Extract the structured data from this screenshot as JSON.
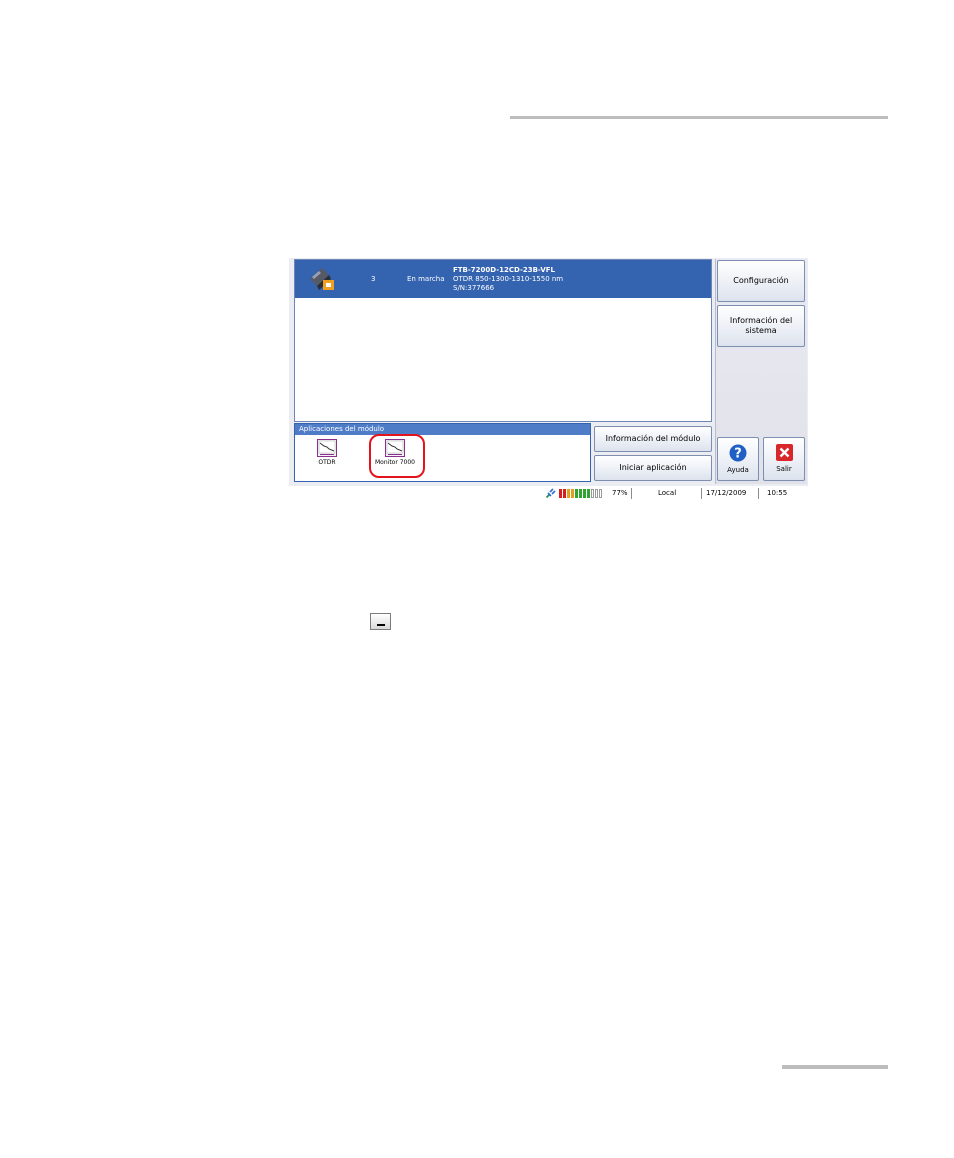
{
  "module": {
    "slot": "3",
    "status": "En marcha",
    "model": "FTB-7200D-12CD-23B-VFL",
    "description": "OTDR 850-1300-1310-1550 nm",
    "serial": "S/N:377666"
  },
  "apps": {
    "header": "Aplicaciones del módulo",
    "items": [
      {
        "label": "OTDR",
        "icon": "otdr-app-icon"
      },
      {
        "label": "Monitor 7000",
        "icon": "monitor-app-icon",
        "highlighted": true
      }
    ]
  },
  "buttons": {
    "module_info": "Información del módulo",
    "start_app": "Iniciar aplicación",
    "configuration": "Configuración",
    "system_info": "Información del\nsistema",
    "help": "Ayuda",
    "exit": "Salir"
  },
  "statusbar": {
    "battery_percent": "77%",
    "battery_level": 0.77,
    "mode": "Local",
    "date": "17/12/2009",
    "time": "10:55"
  },
  "colors": {
    "selection_blue": "#3463b0",
    "highlight_red": "#e3141b",
    "help_blue": "#1f5fc6",
    "exit_red": "#d9262a"
  }
}
